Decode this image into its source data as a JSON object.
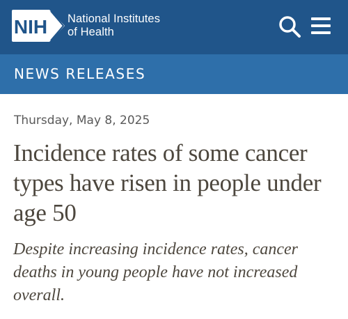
{
  "header": {
    "logo_mark_text": "NIH",
    "logo_line1": "National Institutes",
    "logo_line2": "of Health",
    "search_icon": "search-icon",
    "menu_icon": "menu-icon",
    "colors": {
      "topbar": "#20558a",
      "section_bar": "#2e6faa"
    }
  },
  "section": {
    "label": "NEWS RELEASES"
  },
  "article": {
    "date": "Thursday, May 8, 2025",
    "title": "Incidence rates of some cancer types have risen in people under age 50",
    "subtitle": "Despite increasing incidence rates, cancer deaths in young people have not increased overall."
  }
}
